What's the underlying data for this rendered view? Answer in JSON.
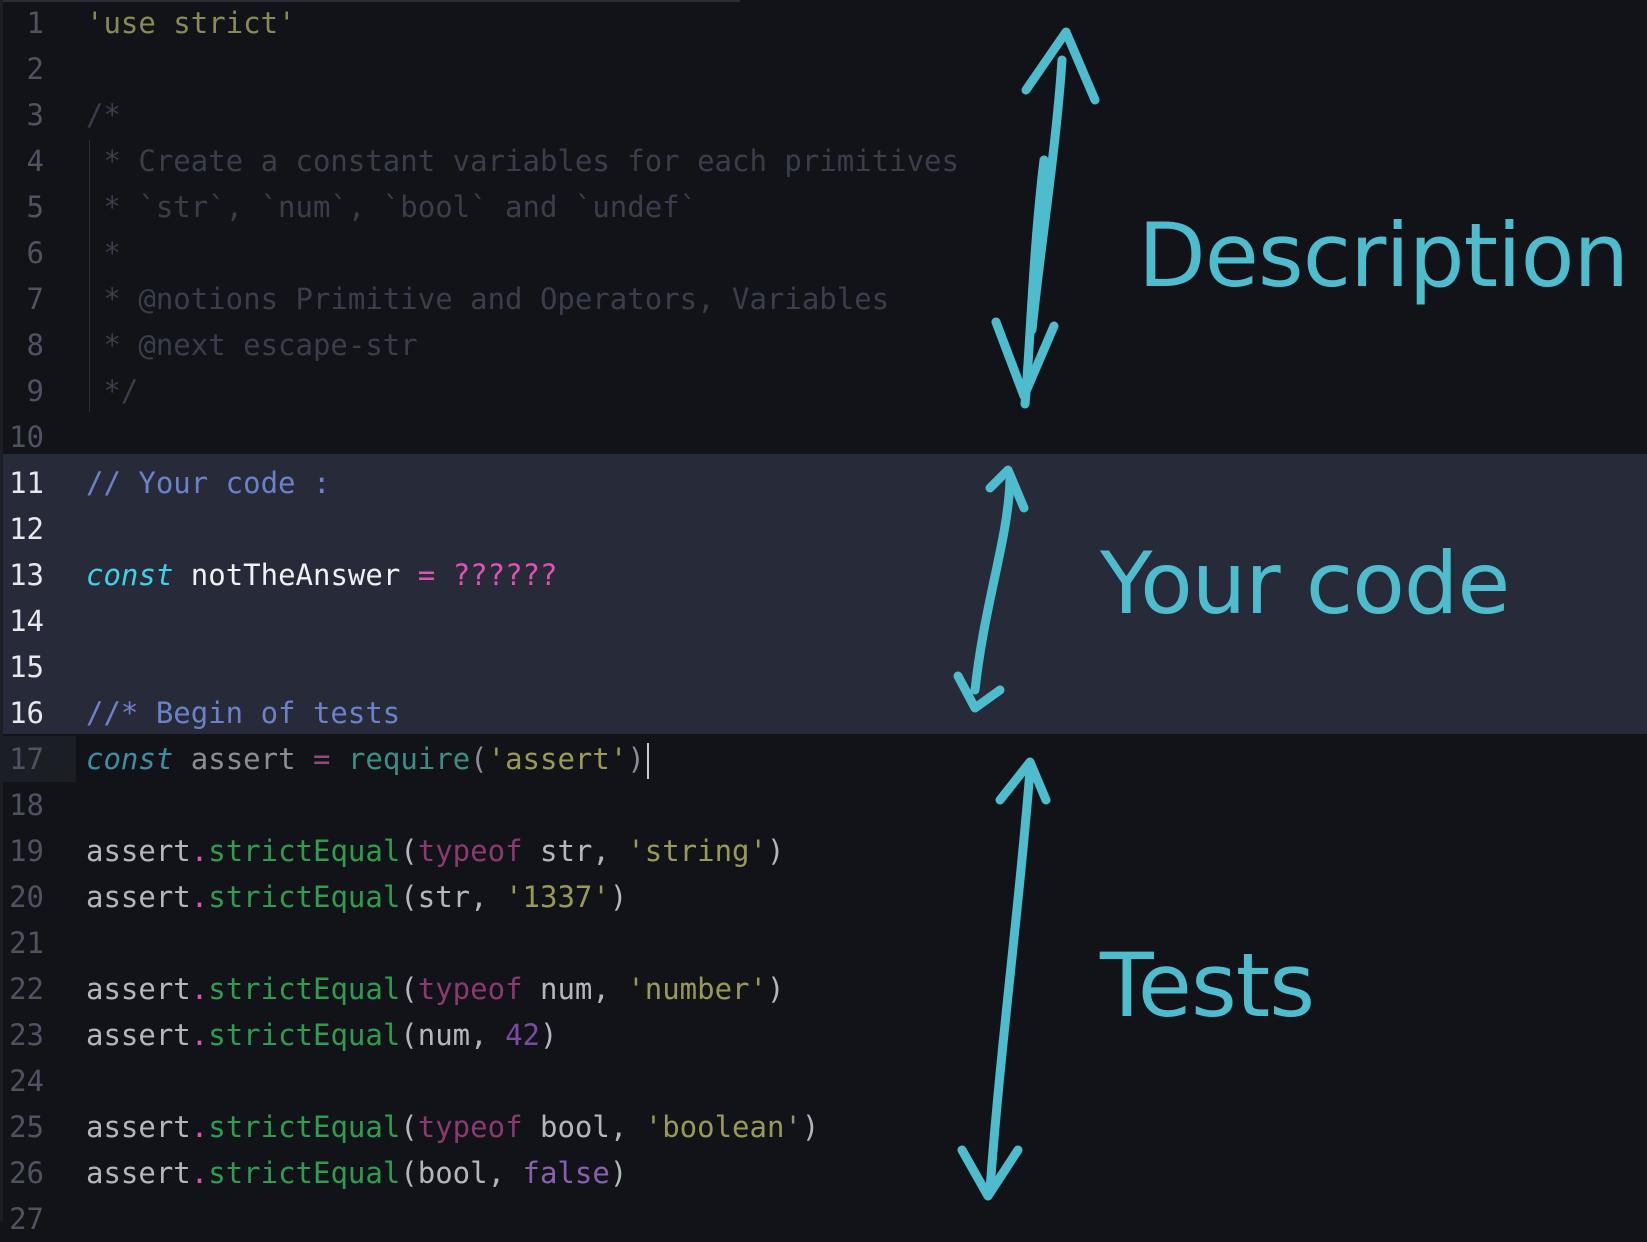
{
  "editor": {
    "lines": [
      {
        "n": "1",
        "tokens": [
          {
            "t": "'use strict'",
            "c": "str-dim"
          }
        ]
      },
      {
        "n": "2",
        "tokens": []
      },
      {
        "n": "3",
        "tokens": [
          {
            "t": "/*",
            "c": "comment"
          }
        ]
      },
      {
        "n": "4",
        "tokens": [
          {
            "t": " * Create a constant variables for each primitives",
            "c": "comment"
          }
        ]
      },
      {
        "n": "5",
        "tokens": [
          {
            "t": " * `str`, `num`, `bool` and `undef`",
            "c": "comment"
          }
        ]
      },
      {
        "n": "6",
        "tokens": [
          {
            "t": " *",
            "c": "comment"
          }
        ]
      },
      {
        "n": "7",
        "tokens": [
          {
            "t": " * @notions Primitive and Operators, Variables",
            "c": "comment"
          }
        ]
      },
      {
        "n": "8",
        "tokens": [
          {
            "t": " * @next escape-str",
            "c": "comment"
          }
        ]
      },
      {
        "n": "9",
        "tokens": [
          {
            "t": " */",
            "c": "comment"
          }
        ]
      },
      {
        "n": "10",
        "tokens": []
      },
      {
        "n": "11",
        "active": true,
        "tokens": [
          {
            "t": "// Your code :",
            "c": "cmt-code"
          }
        ]
      },
      {
        "n": "12",
        "active": true,
        "tokens": []
      },
      {
        "n": "13",
        "active": true,
        "tokens": [
          {
            "t": "const",
            "c": "kw"
          },
          {
            "t": " notTheAnswer ",
            "c": "ident-bright"
          },
          {
            "t": "=",
            "c": "op"
          },
          {
            "t": " ",
            "c": "plain"
          },
          {
            "t": "??????",
            "c": "op"
          }
        ]
      },
      {
        "n": "14",
        "active": true,
        "tokens": []
      },
      {
        "n": "15",
        "active": true,
        "tokens": []
      },
      {
        "n": "16",
        "active": true,
        "tokens": [
          {
            "t": "//* Begin of tests",
            "c": "cmt-code"
          }
        ]
      },
      {
        "n": "17",
        "tokens": [
          {
            "t": "const",
            "c": "kw-dim"
          },
          {
            "t": " assert ",
            "c": "plain-dim"
          },
          {
            "t": "=",
            "c": "op-dim"
          },
          {
            "t": " ",
            "c": "plain"
          },
          {
            "t": "require",
            "c": "call-dim"
          },
          {
            "t": "(",
            "c": "plain-dim"
          },
          {
            "t": "'assert'",
            "c": "str"
          },
          {
            "t": ")",
            "c": "plain-dim"
          }
        ],
        "cursor": true
      },
      {
        "n": "18",
        "tokens": []
      },
      {
        "n": "19",
        "tokens": [
          {
            "t": "assert",
            "c": "plain"
          },
          {
            "t": ".",
            "c": "op"
          },
          {
            "t": "strictEqual",
            "c": "call"
          },
          {
            "t": "(",
            "c": "plain"
          },
          {
            "t": "typeof",
            "c": "typeof"
          },
          {
            "t": " str, ",
            "c": "plain"
          },
          {
            "t": "'string'",
            "c": "str"
          },
          {
            "t": ")",
            "c": "plain"
          }
        ]
      },
      {
        "n": "20",
        "tokens": [
          {
            "t": "assert",
            "c": "plain"
          },
          {
            "t": ".",
            "c": "op"
          },
          {
            "t": "strictEqual",
            "c": "call"
          },
          {
            "t": "(str, ",
            "c": "plain"
          },
          {
            "t": "'1337'",
            "c": "str"
          },
          {
            "t": ")",
            "c": "plain"
          }
        ]
      },
      {
        "n": "21",
        "tokens": []
      },
      {
        "n": "22",
        "tokens": [
          {
            "t": "assert",
            "c": "plain"
          },
          {
            "t": ".",
            "c": "op"
          },
          {
            "t": "strictEqual",
            "c": "call"
          },
          {
            "t": "(",
            "c": "plain"
          },
          {
            "t": "typeof",
            "c": "typeof"
          },
          {
            "t": " num, ",
            "c": "plain"
          },
          {
            "t": "'number'",
            "c": "str"
          },
          {
            "t": ")",
            "c": "plain"
          }
        ]
      },
      {
        "n": "23",
        "tokens": [
          {
            "t": "assert",
            "c": "plain"
          },
          {
            "t": ".",
            "c": "op"
          },
          {
            "t": "strictEqual",
            "c": "call"
          },
          {
            "t": "(num, ",
            "c": "plain"
          },
          {
            "t": "42",
            "c": "num"
          },
          {
            "t": ")",
            "c": "plain"
          }
        ]
      },
      {
        "n": "24",
        "tokens": []
      },
      {
        "n": "25",
        "tokens": [
          {
            "t": "assert",
            "c": "plain"
          },
          {
            "t": ".",
            "c": "op"
          },
          {
            "t": "strictEqual",
            "c": "call"
          },
          {
            "t": "(",
            "c": "plain"
          },
          {
            "t": "typeof",
            "c": "typeof"
          },
          {
            "t": " bool, ",
            "c": "plain"
          },
          {
            "t": "'boolean'",
            "c": "str"
          },
          {
            "t": ")",
            "c": "plain"
          }
        ]
      },
      {
        "n": "26",
        "tokens": [
          {
            "t": "assert",
            "c": "plain"
          },
          {
            "t": ".",
            "c": "op"
          },
          {
            "t": "strictEqual",
            "c": "call"
          },
          {
            "t": "(bool, ",
            "c": "plain"
          },
          {
            "t": "false",
            "c": "bool"
          },
          {
            "t": ")",
            "c": "plain"
          }
        ]
      },
      {
        "n": "27",
        "tokens": []
      }
    ]
  },
  "annotations": {
    "description": "Description",
    "your_code": "Your code",
    "tests": "Tests",
    "color": "#4fbccd"
  }
}
